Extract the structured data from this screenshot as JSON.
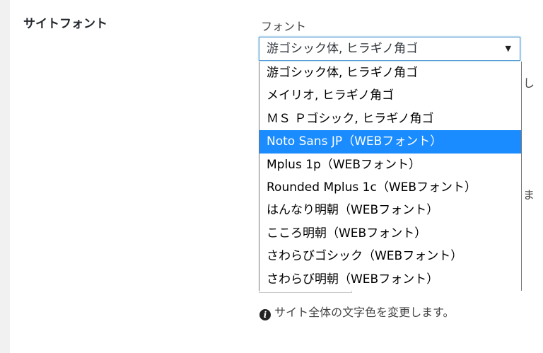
{
  "setting": {
    "title": "サイトフォント",
    "field_label": "フォント"
  },
  "select": {
    "value": "游ゴシック体, ヒラギノ角ゴ",
    "arrow": "▼"
  },
  "options": [
    "游ゴシック体, ヒラギノ角ゴ",
    "メイリオ, ヒラギノ角ゴ",
    "ＭＳ Ｐゴシック, ヒラギノ角ゴ",
    "Noto Sans JP（WEBフォント）",
    "Mplus 1p（WEBフォント）",
    "Rounded Mplus 1c（WEBフォント）",
    "はんなり明朝（WEBフォント）",
    "こころ明朝（WEBフォント）",
    "さわらびゴシック（WEBフォント）",
    "さわらび明朝（WEBフォント）"
  ],
  "selected_index": 3,
  "partial_text": {
    "right_1": "し",
    "right_2": "ま"
  },
  "hint": {
    "icon": "i",
    "text": "サイト全体の文字色を変更します。"
  },
  "colors": {
    "highlight": "#1a8cff",
    "focus_border": "#5b9dd9"
  }
}
